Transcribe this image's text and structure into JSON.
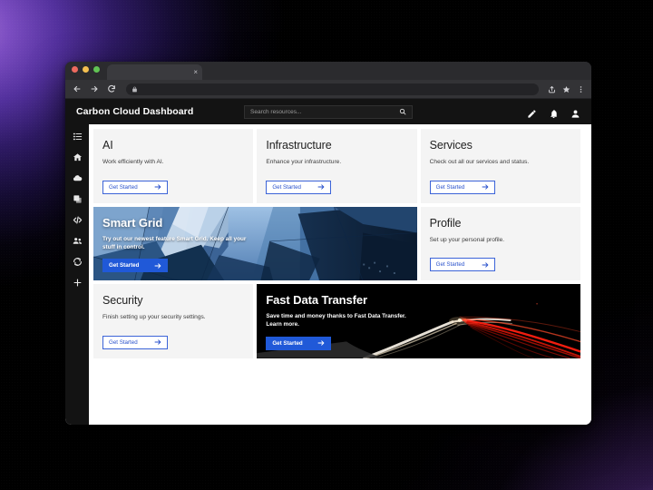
{
  "window": {
    "tab_title": "",
    "tab_close_label": "×",
    "address_value": ""
  },
  "app": {
    "title": "Carbon Cloud Dashboard",
    "search": {
      "placeholder": "Search resources...",
      "value": ""
    },
    "actions": [
      "edit-pencil-icon",
      "notifications-bell-icon",
      "account-person-icon"
    ]
  },
  "sidebar": {
    "items": [
      {
        "icon": "list-menu-icon",
        "name": "sidebar-item-menu"
      },
      {
        "icon": "home-icon",
        "name": "sidebar-item-home"
      },
      {
        "icon": "cloud-icon",
        "name": "sidebar-item-cloud"
      },
      {
        "icon": "database-icon",
        "name": "sidebar-item-storage"
      },
      {
        "icon": "code-icon",
        "name": "sidebar-item-code"
      },
      {
        "icon": "users-icon",
        "name": "sidebar-item-users"
      },
      {
        "icon": "sync-refresh-icon",
        "name": "sidebar-item-sync"
      },
      {
        "icon": "plus-icon",
        "name": "sidebar-item-add"
      }
    ]
  },
  "cards": [
    {
      "id": "ai",
      "title": "AI",
      "description": "Work efficiently with AI.",
      "button": "Get Started",
      "style": "plain"
    },
    {
      "id": "infrastructure",
      "title": "Infrastructure",
      "description": "Enhance your infrastructure.",
      "button": "Get Started",
      "style": "plain"
    },
    {
      "id": "services",
      "title": "Services",
      "description": "Check out all our services and status.",
      "button": "Get Started",
      "style": "plain"
    },
    {
      "id": "smart-grid",
      "title": "Smart Grid",
      "description": "Try out our newest feature Smart Grid. Keep all your stuff in control.",
      "button": "Get Started",
      "style": "media-blue"
    },
    {
      "id": "profile",
      "title": "Profile",
      "description": "Set up your personal profile.",
      "button": "Get Started",
      "style": "plain"
    },
    {
      "id": "security",
      "title": "Security",
      "description": "Finish setting up your security settings.",
      "button": "Get Started",
      "style": "plain"
    },
    {
      "id": "fast-data-transfer",
      "title": "Fast Data Transfer",
      "description": "Save time and money thanks to Fast Data Transfer. Learn more.",
      "button": "Get Started",
      "style": "media-dark"
    }
  ],
  "colors": {
    "accent_blue": "#2059d8",
    "button_outline": "#3c64d8",
    "appbar_bg": "#131313",
    "card_bg": "#f4f4f4",
    "page_bg": "#ffffff",
    "desktop_purple": "#7a4cc0"
  }
}
